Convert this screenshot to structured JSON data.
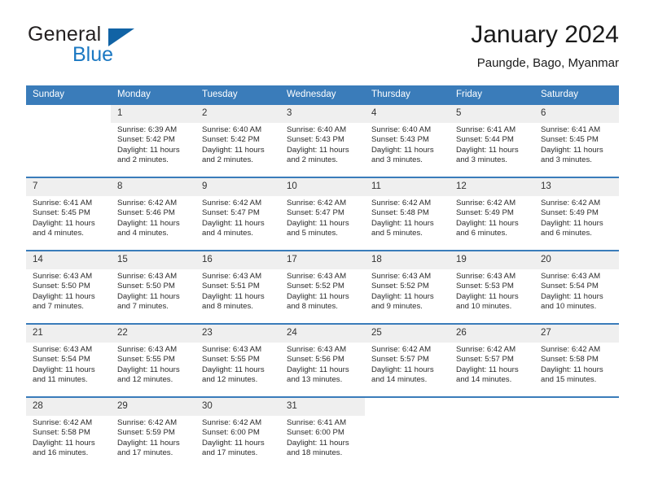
{
  "brand": {
    "name_part1": "General",
    "name_part2": "Blue",
    "triangle_color": "#1163a5",
    "blue_color": "#1b78c2"
  },
  "header": {
    "title": "January 2024",
    "location": "Paungde, Bago, Myanmar",
    "accent_color": "#3a7cba"
  },
  "weekdays": [
    "Sunday",
    "Monday",
    "Tuesday",
    "Wednesday",
    "Thursday",
    "Friday",
    "Saturday"
  ],
  "labels": {
    "sunrise_prefix": "Sunrise:",
    "sunset_prefix": "Sunset:",
    "daylight_prefix": "Daylight:"
  },
  "weeks": [
    [
      {
        "day": "",
        "sunrise": "",
        "sunset": "",
        "daylight": ""
      },
      {
        "day": "1",
        "sunrise": "Sunrise: 6:39 AM",
        "sunset": "Sunset: 5:42 PM",
        "daylight": "Daylight: 11 hours and 2 minutes."
      },
      {
        "day": "2",
        "sunrise": "Sunrise: 6:40 AM",
        "sunset": "Sunset: 5:42 PM",
        "daylight": "Daylight: 11 hours and 2 minutes."
      },
      {
        "day": "3",
        "sunrise": "Sunrise: 6:40 AM",
        "sunset": "Sunset: 5:43 PM",
        "daylight": "Daylight: 11 hours and 2 minutes."
      },
      {
        "day": "4",
        "sunrise": "Sunrise: 6:40 AM",
        "sunset": "Sunset: 5:43 PM",
        "daylight": "Daylight: 11 hours and 3 minutes."
      },
      {
        "day": "5",
        "sunrise": "Sunrise: 6:41 AM",
        "sunset": "Sunset: 5:44 PM",
        "daylight": "Daylight: 11 hours and 3 minutes."
      },
      {
        "day": "6",
        "sunrise": "Sunrise: 6:41 AM",
        "sunset": "Sunset: 5:45 PM",
        "daylight": "Daylight: 11 hours and 3 minutes."
      }
    ],
    [
      {
        "day": "7",
        "sunrise": "Sunrise: 6:41 AM",
        "sunset": "Sunset: 5:45 PM",
        "daylight": "Daylight: 11 hours and 4 minutes."
      },
      {
        "day": "8",
        "sunrise": "Sunrise: 6:42 AM",
        "sunset": "Sunset: 5:46 PM",
        "daylight": "Daylight: 11 hours and 4 minutes."
      },
      {
        "day": "9",
        "sunrise": "Sunrise: 6:42 AM",
        "sunset": "Sunset: 5:47 PM",
        "daylight": "Daylight: 11 hours and 4 minutes."
      },
      {
        "day": "10",
        "sunrise": "Sunrise: 6:42 AM",
        "sunset": "Sunset: 5:47 PM",
        "daylight": "Daylight: 11 hours and 5 minutes."
      },
      {
        "day": "11",
        "sunrise": "Sunrise: 6:42 AM",
        "sunset": "Sunset: 5:48 PM",
        "daylight": "Daylight: 11 hours and 5 minutes."
      },
      {
        "day": "12",
        "sunrise": "Sunrise: 6:42 AM",
        "sunset": "Sunset: 5:49 PM",
        "daylight": "Daylight: 11 hours and 6 minutes."
      },
      {
        "day": "13",
        "sunrise": "Sunrise: 6:42 AM",
        "sunset": "Sunset: 5:49 PM",
        "daylight": "Daylight: 11 hours and 6 minutes."
      }
    ],
    [
      {
        "day": "14",
        "sunrise": "Sunrise: 6:43 AM",
        "sunset": "Sunset: 5:50 PM",
        "daylight": "Daylight: 11 hours and 7 minutes."
      },
      {
        "day": "15",
        "sunrise": "Sunrise: 6:43 AM",
        "sunset": "Sunset: 5:50 PM",
        "daylight": "Daylight: 11 hours and 7 minutes."
      },
      {
        "day": "16",
        "sunrise": "Sunrise: 6:43 AM",
        "sunset": "Sunset: 5:51 PM",
        "daylight": "Daylight: 11 hours and 8 minutes."
      },
      {
        "day": "17",
        "sunrise": "Sunrise: 6:43 AM",
        "sunset": "Sunset: 5:52 PM",
        "daylight": "Daylight: 11 hours and 8 minutes."
      },
      {
        "day": "18",
        "sunrise": "Sunrise: 6:43 AM",
        "sunset": "Sunset: 5:52 PM",
        "daylight": "Daylight: 11 hours and 9 minutes."
      },
      {
        "day": "19",
        "sunrise": "Sunrise: 6:43 AM",
        "sunset": "Sunset: 5:53 PM",
        "daylight": "Daylight: 11 hours and 10 minutes."
      },
      {
        "day": "20",
        "sunrise": "Sunrise: 6:43 AM",
        "sunset": "Sunset: 5:54 PM",
        "daylight": "Daylight: 11 hours and 10 minutes."
      }
    ],
    [
      {
        "day": "21",
        "sunrise": "Sunrise: 6:43 AM",
        "sunset": "Sunset: 5:54 PM",
        "daylight": "Daylight: 11 hours and 11 minutes."
      },
      {
        "day": "22",
        "sunrise": "Sunrise: 6:43 AM",
        "sunset": "Sunset: 5:55 PM",
        "daylight": "Daylight: 11 hours and 12 minutes."
      },
      {
        "day": "23",
        "sunrise": "Sunrise: 6:43 AM",
        "sunset": "Sunset: 5:55 PM",
        "daylight": "Daylight: 11 hours and 12 minutes."
      },
      {
        "day": "24",
        "sunrise": "Sunrise: 6:43 AM",
        "sunset": "Sunset: 5:56 PM",
        "daylight": "Daylight: 11 hours and 13 minutes."
      },
      {
        "day": "25",
        "sunrise": "Sunrise: 6:42 AM",
        "sunset": "Sunset: 5:57 PM",
        "daylight": "Daylight: 11 hours and 14 minutes."
      },
      {
        "day": "26",
        "sunrise": "Sunrise: 6:42 AM",
        "sunset": "Sunset: 5:57 PM",
        "daylight": "Daylight: 11 hours and 14 minutes."
      },
      {
        "day": "27",
        "sunrise": "Sunrise: 6:42 AM",
        "sunset": "Sunset: 5:58 PM",
        "daylight": "Daylight: 11 hours and 15 minutes."
      }
    ],
    [
      {
        "day": "28",
        "sunrise": "Sunrise: 6:42 AM",
        "sunset": "Sunset: 5:58 PM",
        "daylight": "Daylight: 11 hours and 16 minutes."
      },
      {
        "day": "29",
        "sunrise": "Sunrise: 6:42 AM",
        "sunset": "Sunset: 5:59 PM",
        "daylight": "Daylight: 11 hours and 17 minutes."
      },
      {
        "day": "30",
        "sunrise": "Sunrise: 6:42 AM",
        "sunset": "Sunset: 6:00 PM",
        "daylight": "Daylight: 11 hours and 17 minutes."
      },
      {
        "day": "31",
        "sunrise": "Sunrise: 6:41 AM",
        "sunset": "Sunset: 6:00 PM",
        "daylight": "Daylight: 11 hours and 18 minutes."
      },
      {
        "day": "",
        "sunrise": "",
        "sunset": "",
        "daylight": ""
      },
      {
        "day": "",
        "sunrise": "",
        "sunset": "",
        "daylight": ""
      },
      {
        "day": "",
        "sunrise": "",
        "sunset": "",
        "daylight": ""
      }
    ]
  ]
}
